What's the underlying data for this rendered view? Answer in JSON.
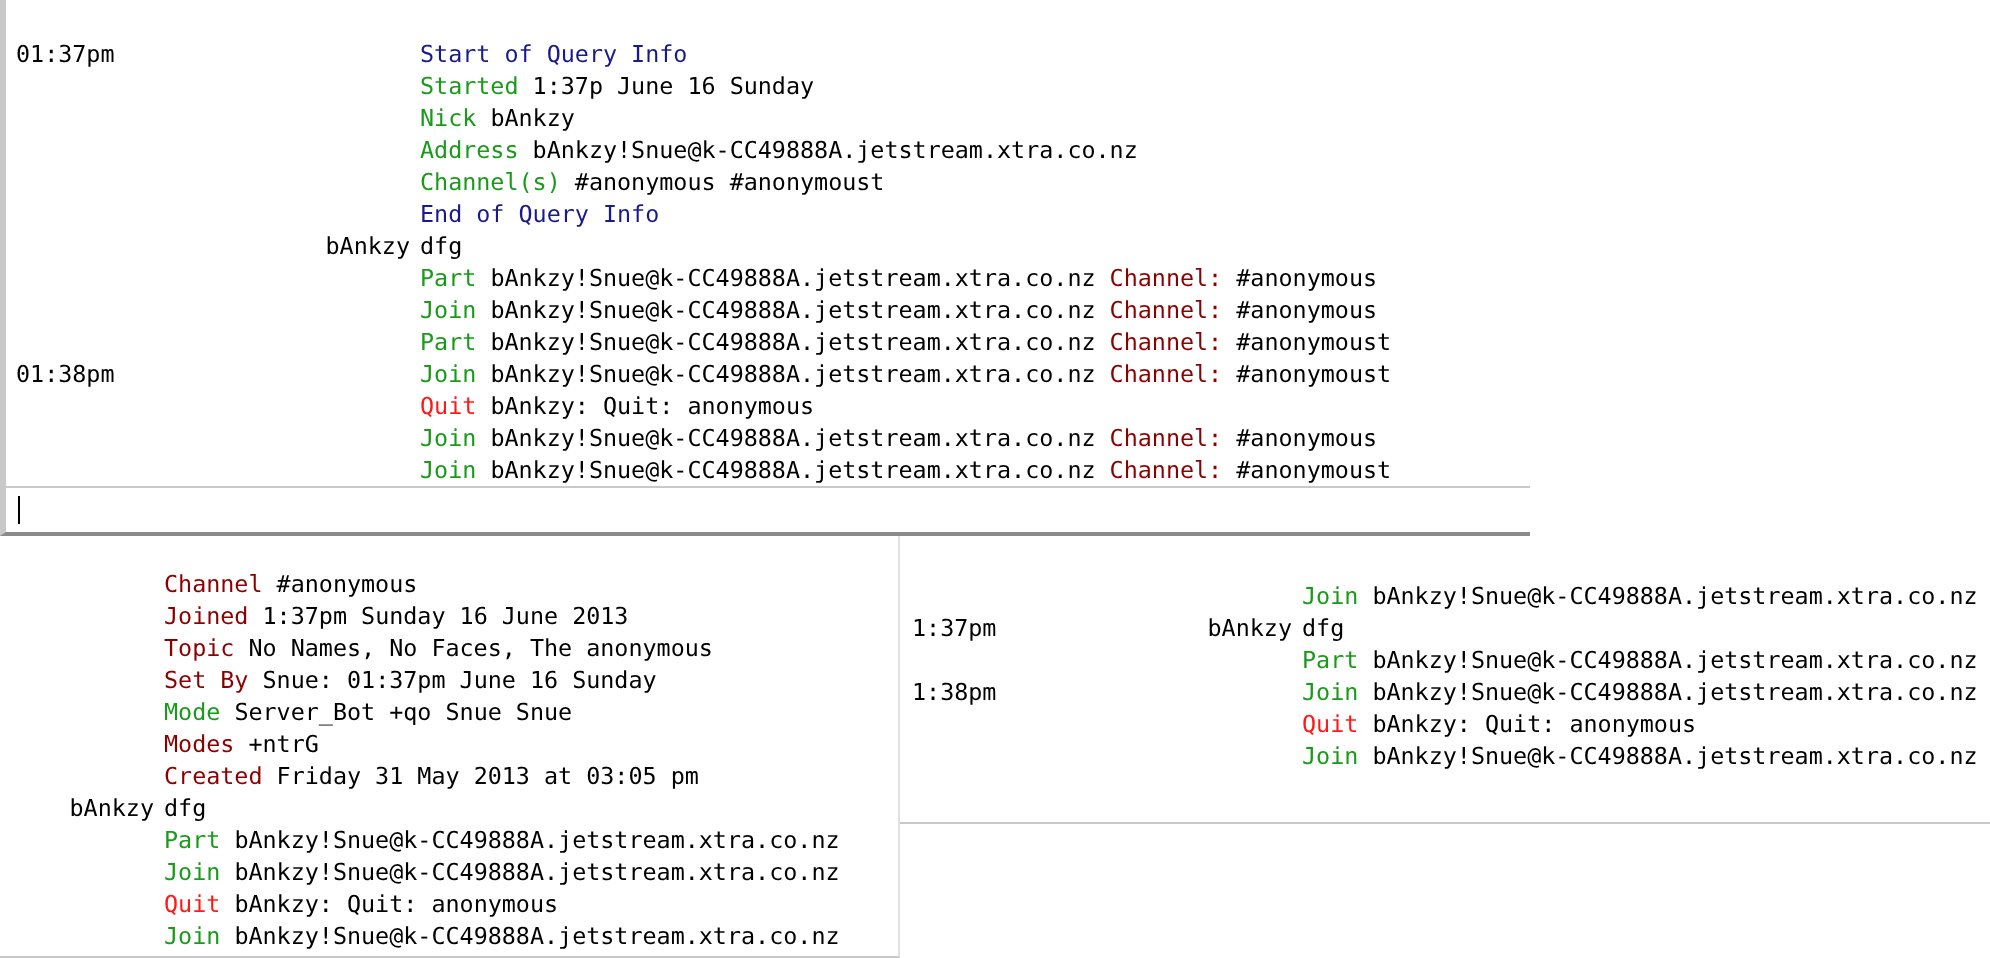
{
  "panes": [
    {
      "kind": "main",
      "lines": [
        {
          "time": "01:37pm",
          "parts": [
            {
              "kind": "info",
              "text": "Start of Query Info"
            }
          ]
        },
        {
          "parts": [
            {
              "kind": "event",
              "text": "Started"
            },
            {
              "kind": "text",
              "text": "1:37p June 16 Sunday"
            }
          ]
        },
        {
          "parts": [
            {
              "kind": "event",
              "text": "Nick"
            },
            {
              "kind": "text",
              "text": "bAnkzy"
            }
          ]
        },
        {
          "parts": [
            {
              "kind": "event",
              "text": "Address"
            },
            {
              "kind": "text",
              "text": "bAnkzy!Snue@k-CC49888A.jetstream.xtra.co.nz"
            }
          ]
        },
        {
          "parts": [
            {
              "kind": "event",
              "text": "Channel(s)"
            },
            {
              "kind": "text",
              "text": "#anonymous #anonymoust"
            }
          ]
        },
        {
          "parts": [
            {
              "kind": "info",
              "text": "End of Query Info"
            }
          ]
        },
        {
          "nick": "bAnkzy",
          "parts": [
            {
              "kind": "text",
              "text": "dfg"
            }
          ]
        },
        {
          "parts": [
            {
              "kind": "event",
              "text": "Part"
            },
            {
              "kind": "text",
              "text": "bAnkzy!Snue@k-CC49888A.jetstream.xtra.co.nz"
            },
            {
              "kind": "label",
              "text": "Channel:"
            },
            {
              "kind": "text",
              "text": "#anonymous"
            }
          ]
        },
        {
          "parts": [
            {
              "kind": "event",
              "text": "Join"
            },
            {
              "kind": "text",
              "text": "bAnkzy!Snue@k-CC49888A.jetstream.xtra.co.nz"
            },
            {
              "kind": "label",
              "text": "Channel:"
            },
            {
              "kind": "text",
              "text": "#anonymous"
            }
          ]
        },
        {
          "parts": [
            {
              "kind": "event",
              "text": "Part"
            },
            {
              "kind": "text",
              "text": "bAnkzy!Snue@k-CC49888A.jetstream.xtra.co.nz"
            },
            {
              "kind": "label",
              "text": "Channel:"
            },
            {
              "kind": "text",
              "text": "#anonymoust"
            }
          ]
        },
        {
          "time": "01:38pm",
          "parts": [
            {
              "kind": "event",
              "text": "Join"
            },
            {
              "kind": "text",
              "text": "bAnkzy!Snue@k-CC49888A.jetstream.xtra.co.nz"
            },
            {
              "kind": "label",
              "text": "Channel:"
            },
            {
              "kind": "text",
              "text": "#anonymoust"
            }
          ]
        },
        {
          "parts": [
            {
              "kind": "quit",
              "text": "Quit"
            },
            {
              "kind": "text",
              "text": "bAnkzy: Quit: anonymous"
            }
          ]
        },
        {
          "parts": [
            {
              "kind": "event",
              "text": "Join"
            },
            {
              "kind": "text",
              "text": "bAnkzy!Snue@k-CC49888A.jetstream.xtra.co.nz"
            },
            {
              "kind": "label",
              "text": "Channel:"
            },
            {
              "kind": "text",
              "text": "#anonymous"
            }
          ]
        },
        {
          "parts": [
            {
              "kind": "event",
              "text": "Join"
            },
            {
              "kind": "text",
              "text": "bAnkzy!Snue@k-CC49888A.jetstream.xtra.co.nz"
            },
            {
              "kind": "label",
              "text": "Channel:"
            },
            {
              "kind": "text",
              "text": "#anonymoust"
            }
          ]
        }
      ]
    },
    {
      "kind": "channel",
      "lines": [
        {
          "parts": [
            {
              "kind": "label",
              "text": "Channel"
            },
            {
              "kind": "text",
              "text": "#anonymous"
            }
          ]
        },
        {
          "parts": [
            {
              "kind": "label",
              "text": "Joined"
            },
            {
              "kind": "text",
              "text": "1:37pm Sunday 16 June 2013"
            }
          ]
        },
        {
          "parts": [
            {
              "kind": "label",
              "text": "Topic"
            },
            {
              "kind": "text",
              "text": "No Names, No Faces, The anonymous"
            }
          ]
        },
        {
          "parts": [
            {
              "kind": "label",
              "text": "Set By"
            },
            {
              "kind": "text",
              "text": "Snue: 01:37pm June 16 Sunday"
            }
          ]
        },
        {
          "parts": [
            {
              "kind": "event",
              "text": "Mode"
            },
            {
              "kind": "text",
              "text": "Server_Bot +qo Snue Snue"
            }
          ]
        },
        {
          "parts": [
            {
              "kind": "label",
              "text": "Modes"
            },
            {
              "kind": "text",
              "text": "+ntrG"
            }
          ]
        },
        {
          "parts": [
            {
              "kind": "label",
              "text": "Created"
            },
            {
              "kind": "text",
              "text": "Friday 31 May 2013 at 03:05 pm"
            }
          ]
        },
        {
          "nick": "bAnkzy",
          "parts": [
            {
              "kind": "text",
              "text": "dfg"
            }
          ]
        },
        {
          "parts": [
            {
              "kind": "event",
              "text": "Part"
            },
            {
              "kind": "text",
              "text": "bAnkzy!Snue@k-CC49888A.jetstream.xtra.co.nz"
            }
          ]
        },
        {
          "parts": [
            {
              "kind": "event",
              "text": "Join"
            },
            {
              "kind": "text",
              "text": "bAnkzy!Snue@k-CC49888A.jetstream.xtra.co.nz"
            }
          ]
        },
        {
          "parts": [
            {
              "kind": "quit",
              "text": "Quit"
            },
            {
              "kind": "text",
              "text": "bAnkzy: Quit: anonymous"
            }
          ]
        },
        {
          "parts": [
            {
              "kind": "event",
              "text": "Join"
            },
            {
              "kind": "text",
              "text": "bAnkzy!Snue@k-CC49888A.jetstream.xtra.co.nz"
            }
          ]
        }
      ]
    },
    {
      "kind": "partial",
      "lines": [
        {
          "parts": [
            {
              "kind": "event",
              "text": "Join"
            },
            {
              "kind": "text",
              "text": "bAnkzy!Snue@k-CC49888A.jetstream.xtra.co.nz"
            }
          ]
        },
        {
          "time": "1:37pm",
          "nick": "bAnkzy",
          "parts": [
            {
              "kind": "text",
              "text": "dfg"
            }
          ]
        },
        {
          "parts": [
            {
              "kind": "event",
              "text": "Part"
            },
            {
              "kind": "text",
              "text": "bAnkzy!Snue@k-CC49888A.jetstream.xtra.co.nz"
            }
          ]
        },
        {
          "time": "1:38pm",
          "parts": [
            {
              "kind": "event",
              "text": "Join"
            },
            {
              "kind": "text",
              "text": "bAnkzy!Snue@k-CC49888A.jetstream.xtra.co.nz"
            }
          ]
        },
        {
          "parts": [
            {
              "kind": "quit",
              "text": "Quit"
            },
            {
              "kind": "text",
              "text": "bAnkzy: Quit: anonymous"
            }
          ]
        },
        {
          "parts": [
            {
              "kind": "event",
              "text": "Join"
            },
            {
              "kind": "text",
              "text": "bAnkzy!Snue@k-CC49888A.jetstream.xtra.co.nz"
            }
          ]
        }
      ]
    }
  ]
}
